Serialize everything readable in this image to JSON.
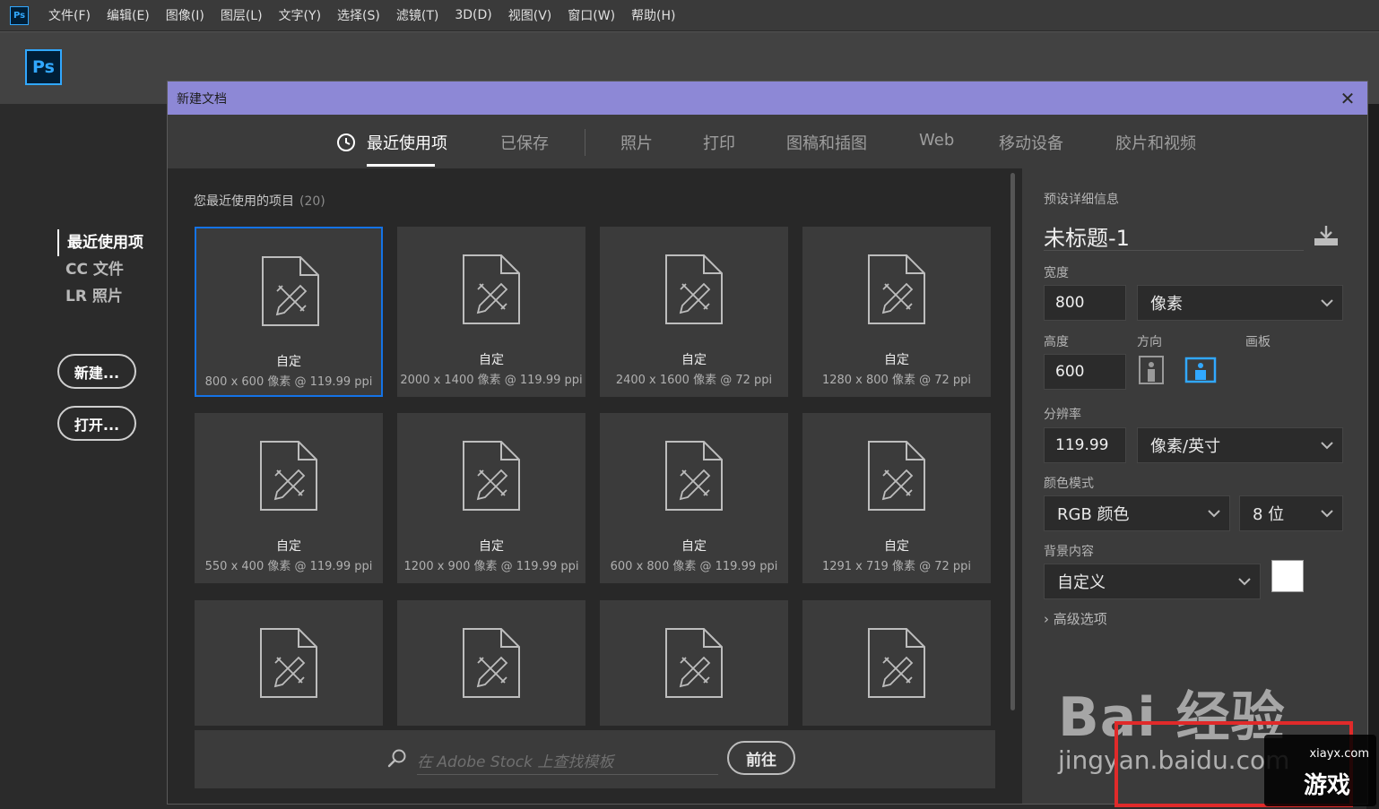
{
  "app": {
    "badge": "Ps",
    "menu": [
      "文件(F)",
      "编辑(E)",
      "图像(I)",
      "图层(L)",
      "文字(Y)",
      "选择(S)",
      "滤镜(T)",
      "3D(D)",
      "视图(V)",
      "窗口(W)",
      "帮助(H)"
    ]
  },
  "home": {
    "logo": "Ps",
    "nav": [
      "最近使用项",
      "CC 文件",
      "LR 照片"
    ],
    "new_button": "新建...",
    "open_button": "打开..."
  },
  "dialog": {
    "title": "新建文档",
    "close_glyph": "✕",
    "tabs": [
      "最近使用项",
      "已保存",
      "照片",
      "打印",
      "图稿和插图",
      "Web",
      "移动设备",
      "胶片和视频"
    ],
    "recent": {
      "title": "您最近使用的项目",
      "count": "(20)",
      "cards": [
        {
          "name": "自定",
          "size": "800 x 600 像素 @ 119.99 ppi"
        },
        {
          "name": "自定",
          "size": "2000 x 1400 像素 @ 119.99 ppi"
        },
        {
          "name": "自定",
          "size": "2400 x 1600 像素 @ 72 ppi"
        },
        {
          "name": "自定",
          "size": "1280 x 800 像素 @ 72 ppi"
        },
        {
          "name": "自定",
          "size": "550 x 400 像素 @ 119.99 ppi"
        },
        {
          "name": "自定",
          "size": "1200 x 900 像素 @ 119.99 ppi"
        },
        {
          "name": "自定",
          "size": "600 x 800 像素 @ 119.99 ppi"
        },
        {
          "name": "自定",
          "size": "1291 x 719 像素 @ 72 ppi"
        },
        {
          "name": "",
          "size": ""
        },
        {
          "name": "",
          "size": ""
        },
        {
          "name": "",
          "size": ""
        },
        {
          "name": "",
          "size": ""
        }
      ]
    },
    "stock": {
      "placeholder": "在 Adobe Stock 上查找模板",
      "go_button": "前往"
    },
    "preset": {
      "section_label": "预设详细信息",
      "doc_name": "未标题-1",
      "width_label": "宽度",
      "width_value": "800",
      "width_unit": "像素",
      "height_label": "高度",
      "height_value": "600",
      "orientation_label": "方向",
      "artboard_label": "画板",
      "resolution_label": "分辨率",
      "resolution_value": "119.99",
      "resolution_unit": "像素/英寸",
      "color_mode_label": "颜色模式",
      "color_mode": "RGB 颜色",
      "bit_depth": "8 位",
      "background_label": "背景内容",
      "background": "自定义",
      "background_color": "#ffffff",
      "advanced": "高级选项"
    }
  },
  "watermark": {
    "baidu": "Bai 经验",
    "jingyan": "jingyan.baidu.com",
    "site": "xiayx.com",
    "brand": "游戏"
  },
  "colors": {
    "accent": "#1473e6",
    "title_bar": "#8d88d6",
    "ps_blue": "#31a8ff"
  }
}
